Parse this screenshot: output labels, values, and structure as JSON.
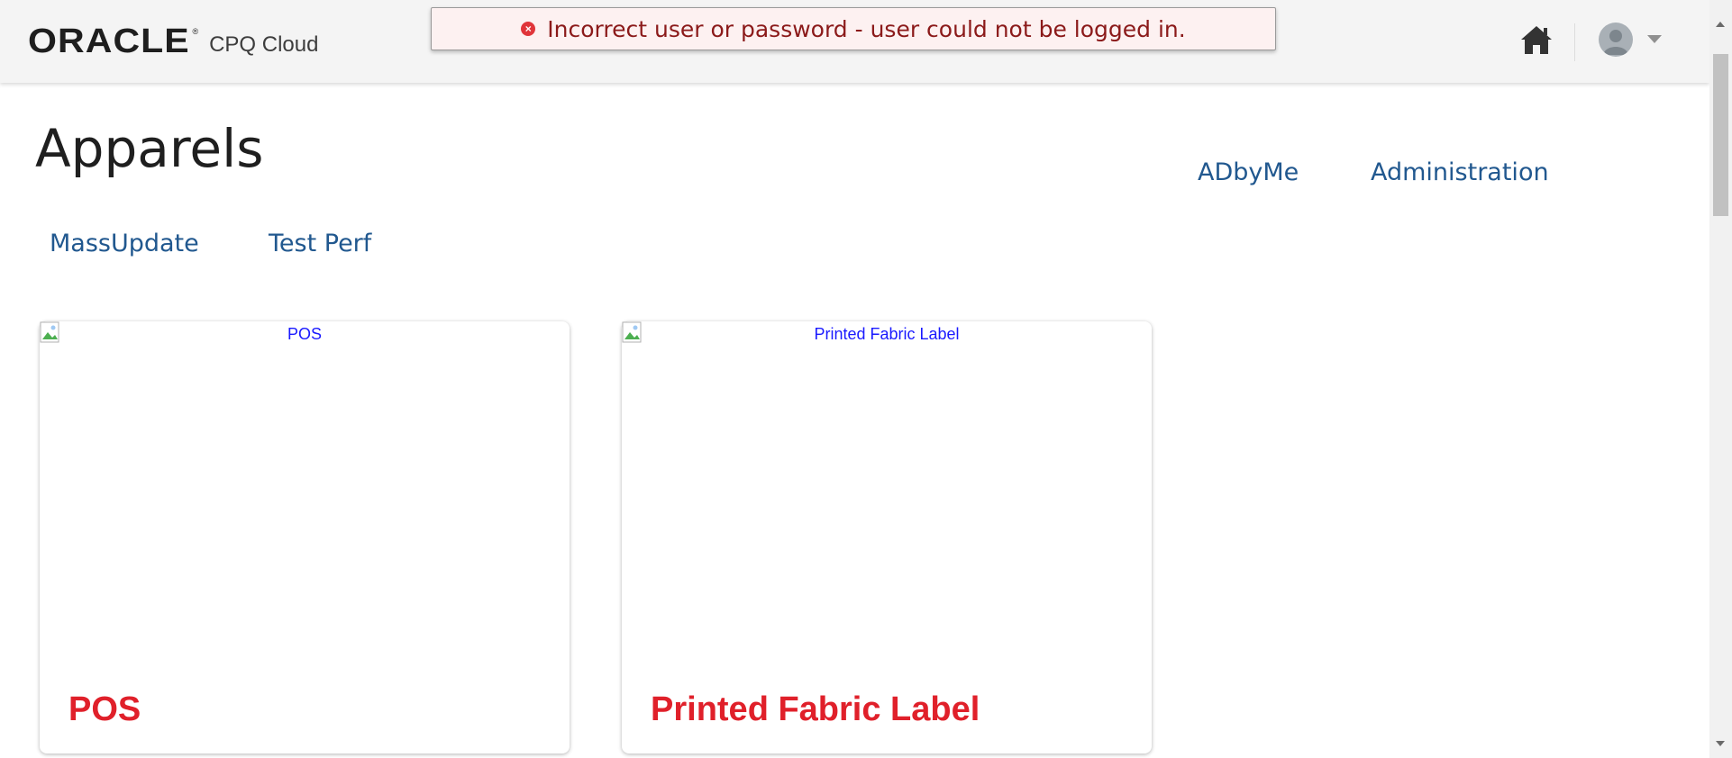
{
  "header": {
    "logo_text": "ORACLE",
    "logo_reg": "®",
    "product": "CPQ Cloud",
    "home_icon": "home-icon",
    "user_icon": "user-avatar-icon"
  },
  "error": {
    "icon": "error-x-icon",
    "glyph": "×",
    "message": "Incorrect user or password - user could not be logged in."
  },
  "page": {
    "title": "Apparels"
  },
  "nav": {
    "top_links": [
      "ADbyMe",
      "Administration"
    ],
    "links": [
      "MassUpdate",
      "Test Perf"
    ]
  },
  "cards": [
    {
      "alt": "POS",
      "title": "POS"
    },
    {
      "alt": "Printed Fabric Label",
      "title": "Printed Fabric Label"
    }
  ],
  "colors": {
    "header_bg": "#f4f4f4",
    "link": "#21588f",
    "card_title": "#e0202a",
    "error_text": "#8b1a1a",
    "error_bg": "#fdf1f1"
  }
}
